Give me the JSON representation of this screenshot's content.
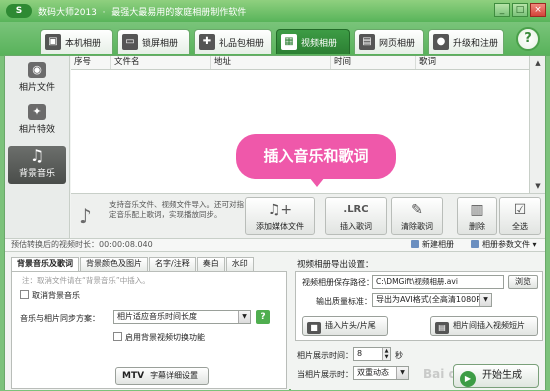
{
  "titlebar": {
    "logo": "S",
    "app_name": "数码大师2013",
    "subtitle": "最强大最易用的家庭相册制作软件",
    "min": "_",
    "max": "□",
    "close": "×"
  },
  "tabs": [
    {
      "label": "本机相册",
      "icon": "computer-icon"
    },
    {
      "label": "锁屏相册",
      "icon": "monitor-icon"
    },
    {
      "label": "礼品包相册",
      "icon": "gift-icon"
    },
    {
      "label": "视频相册",
      "icon": "film-icon",
      "active": true
    },
    {
      "label": "网页相册",
      "icon": "web-icon"
    },
    {
      "label": "升级和注册",
      "icon": "upgrade-icon"
    }
  ],
  "help": "?",
  "sidebar": {
    "items": [
      {
        "label": "相片文件",
        "icon": "camera-icon"
      },
      {
        "label": "相片特效",
        "icon": "effects-icon"
      },
      {
        "label": "背景音乐",
        "icon": "music-icon",
        "active": true
      }
    ]
  },
  "table": {
    "columns": [
      "序号",
      "文件名",
      "地址",
      "时间",
      "歌词"
    ]
  },
  "tooltip": "插入音乐和歌词",
  "toolrow": {
    "hint": "支持音乐文件、视频文件导入。还可对指定音乐配上歌词，实现播放同步。",
    "buttons": [
      {
        "label": "添加媒体文件",
        "icon": "add-music-icon"
      },
      {
        "label": "插入歌词",
        "icon_text": ".LRC"
      },
      {
        "label": "清除歌词",
        "icon": "eraser-icon"
      },
      {
        "label": "删除",
        "icon": "delete-icon"
      },
      {
        "label": "全选",
        "icon": "select-all-icon"
      }
    ]
  },
  "status": {
    "text": "预估转换后的视频时长：00:00:08.040",
    "new_album": "新建相册",
    "ref_file": "相册参数文件"
  },
  "lower_left": {
    "tabs": [
      "背景音乐及歌词",
      "背景颜色及图片",
      "名字/注释",
      "奏白",
      "水印"
    ],
    "note": "注：取消文件请在“背景音乐”中插入。",
    "cancel_bgm": "取消背景音乐",
    "sync_label": "音乐与相片同步方案：",
    "sync_value": "相片适应音乐时间长度",
    "bg_switch": "启用背景视频切换功能",
    "mtv_prefix": "MTV",
    "mtv_label": "字幕详细设置",
    "help": "?"
  },
  "lower_right": {
    "heading": "视频相册导出设置：",
    "path_label": "视频相册保存路径：",
    "path_value": "C:\\DMGift\\视频相册.avi",
    "browse": "浏览",
    "quality_label": "输出质量标准：",
    "quality_value": "导出为AVI格式(全高清1080P)",
    "insert_intro": "插入片头/片尾",
    "insert_trans": "相片间插入视频短片",
    "duration_label": "相片展示时间：",
    "duration_value": "8",
    "duration_unit": "秒",
    "effect_label": "当相片展示时：",
    "effect_value": "双重动态",
    "start": "开始生成"
  },
  "watermark": "Bai du 经验"
}
